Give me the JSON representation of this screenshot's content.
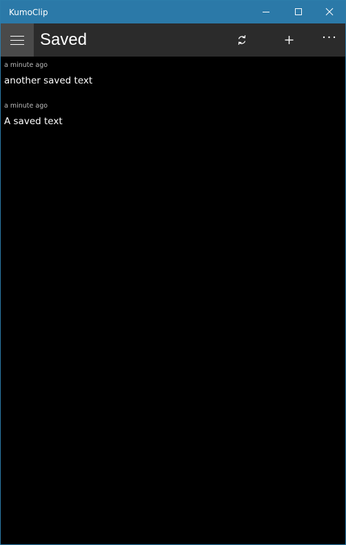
{
  "window": {
    "title": "KumoClip",
    "controls": [
      {
        "name": "minimize",
        "icon": "minimize-icon"
      },
      {
        "name": "maximize",
        "icon": "maximize-icon"
      },
      {
        "name": "close",
        "icon": "close-icon"
      }
    ]
  },
  "appbar": {
    "menu_icon": "hamburger-icon",
    "title": "Saved",
    "actions": [
      {
        "name": "sync",
        "icon": "sync-icon"
      },
      {
        "name": "add",
        "icon": "plus-icon"
      },
      {
        "name": "more",
        "icon": "more-icon"
      }
    ]
  },
  "items": [
    {
      "time": "a minute ago",
      "text": "another saved text"
    },
    {
      "time": "a minute ago",
      "text": "A saved text"
    }
  ],
  "colors": {
    "titlebar": "#2b79a8",
    "appbar": "#2b2b2b",
    "hamburger_bg": "#4a4a4a",
    "background": "#000000",
    "text": "#ffffff",
    "subtext": "#bdbdbd"
  }
}
